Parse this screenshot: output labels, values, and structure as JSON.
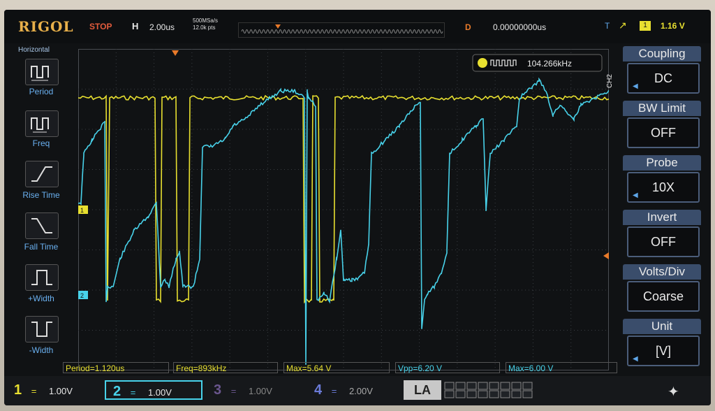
{
  "header": {
    "brand": "RIGOL",
    "run_state": "STOP",
    "horizontal_mode": "H",
    "timebase": "2.00us",
    "sample_rate": "500MSa/s",
    "memory_depth": "12.0k pts",
    "delay_label": "D",
    "delay_value": "0.00000000us",
    "trigger_type": "T",
    "trigger_source": "1",
    "trigger_level": "1.16 V"
  },
  "left_menu": {
    "title": "Horizontal",
    "items": [
      {
        "label": "Period",
        "icon": "period-icon"
      },
      {
        "label": "Freq",
        "icon": "frequency-icon"
      },
      {
        "label": "Rise Time",
        "icon": "rise-time-icon"
      },
      {
        "label": "Fall Time",
        "icon": "fall-time-icon"
      },
      {
        "label": "+Width",
        "icon": "positive-width-icon"
      },
      {
        "label": "-Width",
        "icon": "negative-width-icon"
      }
    ]
  },
  "frequency_counter": "104.266kHz",
  "channel_side_label": "CH2",
  "right_menu": {
    "items": [
      {
        "title": "Coupling",
        "value": "DC",
        "arrow": true
      },
      {
        "title": "BW Limit",
        "value": "OFF",
        "arrow": false
      },
      {
        "title": "Probe",
        "value": "10X",
        "arrow": true
      },
      {
        "title": "Invert",
        "value": "OFF",
        "arrow": false
      },
      {
        "title": "Volts/Div",
        "value": "Coarse",
        "arrow": false
      },
      {
        "title": "Unit",
        "value": "[V]",
        "arrow": true
      }
    ]
  },
  "measurements": [
    {
      "text": "Period=1.120us",
      "color": "yellow"
    },
    {
      "text": "Freq=893kHz",
      "color": "yellow"
    },
    {
      "text": "Max=5.64 V",
      "color": "yellow"
    },
    {
      "text": "Vpp=6.20 V",
      "color": "cyan"
    },
    {
      "text": "Max=6.00 V",
      "color": "cyan"
    }
  ],
  "channels": [
    {
      "num": "1",
      "scale": "1.00V",
      "color": "#e8e030",
      "active": true
    },
    {
      "num": "2",
      "scale": "1.00V",
      "color": "#48d2ea",
      "active": true
    },
    {
      "num": "3",
      "scale": "1.00V",
      "color": "#8a6ad6",
      "active": false
    },
    {
      "num": "4",
      "scale": "2.00V",
      "color": "#6b7bd8",
      "active": false
    }
  ],
  "la_label": "LA",
  "colors": {
    "ch1": "#e8e030",
    "ch2": "#48d2ea",
    "accent": "#e87a2a",
    "menu_header": "#3a4d6b"
  }
}
